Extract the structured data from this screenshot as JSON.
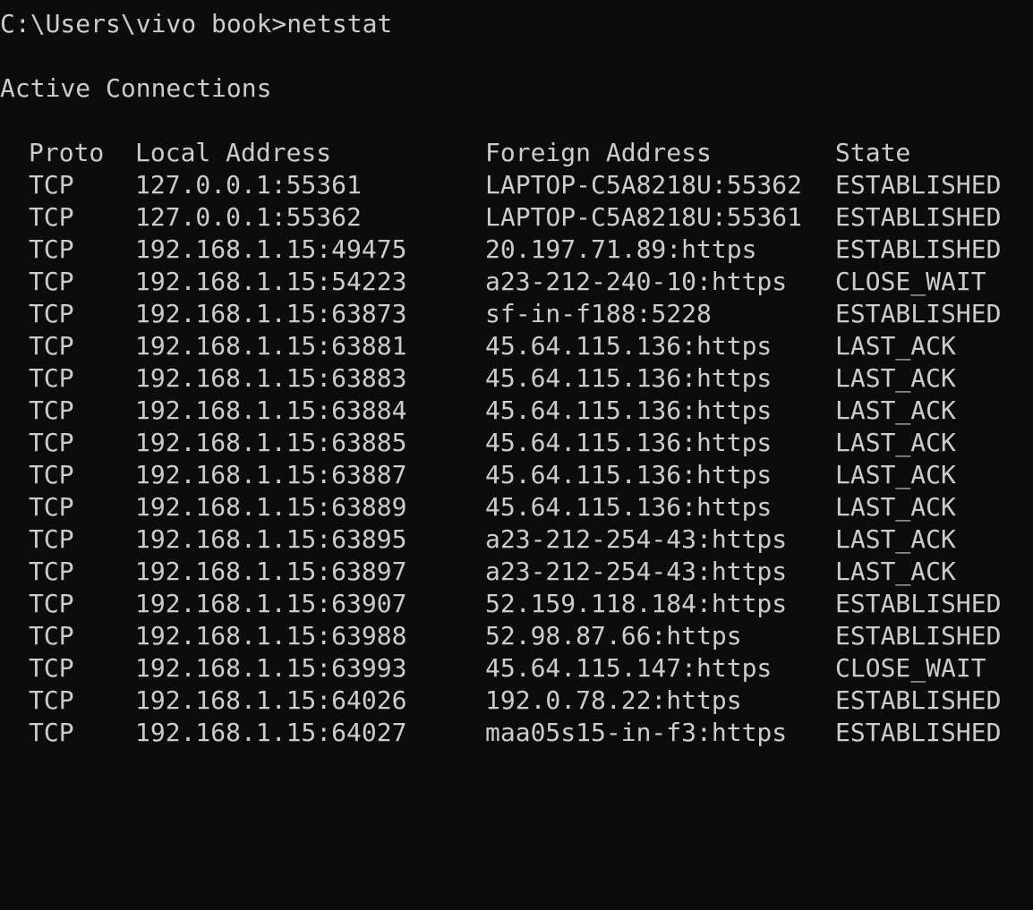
{
  "terminal": {
    "prompt_line": "C:\\Users\\vivo book>netstat",
    "section_title": "Active Connections",
    "headers": {
      "proto": "Proto",
      "local": "Local Address",
      "foreign": "Foreign Address",
      "state": "State"
    },
    "rows": [
      {
        "proto": "TCP",
        "local": "127.0.0.1:55361",
        "foreign": "LAPTOP-C5A8218U:55362",
        "state": "ESTABLISHED"
      },
      {
        "proto": "TCP",
        "local": "127.0.0.1:55362",
        "foreign": "LAPTOP-C5A8218U:55361",
        "state": "ESTABLISHED"
      },
      {
        "proto": "TCP",
        "local": "192.168.1.15:49475",
        "foreign": "20.197.71.89:https",
        "state": "ESTABLISHED"
      },
      {
        "proto": "TCP",
        "local": "192.168.1.15:54223",
        "foreign": "a23-212-240-10:https",
        "state": "CLOSE_WAIT"
      },
      {
        "proto": "TCP",
        "local": "192.168.1.15:63873",
        "foreign": "sf-in-f188:5228",
        "state": "ESTABLISHED"
      },
      {
        "proto": "TCP",
        "local": "192.168.1.15:63881",
        "foreign": "45.64.115.136:https",
        "state": "LAST_ACK"
      },
      {
        "proto": "TCP",
        "local": "192.168.1.15:63883",
        "foreign": "45.64.115.136:https",
        "state": "LAST_ACK"
      },
      {
        "proto": "TCP",
        "local": "192.168.1.15:63884",
        "foreign": "45.64.115.136:https",
        "state": "LAST_ACK"
      },
      {
        "proto": "TCP",
        "local": "192.168.1.15:63885",
        "foreign": "45.64.115.136:https",
        "state": "LAST_ACK"
      },
      {
        "proto": "TCP",
        "local": "192.168.1.15:63887",
        "foreign": "45.64.115.136:https",
        "state": "LAST_ACK"
      },
      {
        "proto": "TCP",
        "local": "192.168.1.15:63889",
        "foreign": "45.64.115.136:https",
        "state": "LAST_ACK"
      },
      {
        "proto": "TCP",
        "local": "192.168.1.15:63895",
        "foreign": "a23-212-254-43:https",
        "state": "LAST_ACK"
      },
      {
        "proto": "TCP",
        "local": "192.168.1.15:63897",
        "foreign": "a23-212-254-43:https",
        "state": "LAST_ACK"
      },
      {
        "proto": "TCP",
        "local": "192.168.1.15:63907",
        "foreign": "52.159.118.184:https",
        "state": "ESTABLISHED"
      },
      {
        "proto": "TCP",
        "local": "192.168.1.15:63988",
        "foreign": "52.98.87.66:https",
        "state": "ESTABLISHED"
      },
      {
        "proto": "TCP",
        "local": "192.168.1.15:63993",
        "foreign": "45.64.115.147:https",
        "state": "CLOSE_WAIT"
      },
      {
        "proto": "TCP",
        "local": "192.168.1.15:64026",
        "foreign": "192.0.78.22:https",
        "state": "ESTABLISHED"
      },
      {
        "proto": "TCP",
        "local": "192.168.1.15:64027",
        "foreign": "maa05s15-in-f3:https",
        "state": "ESTABLISHED"
      }
    ],
    "colors": {
      "background": "#0c0c0c",
      "text": "#cccccc"
    }
  }
}
